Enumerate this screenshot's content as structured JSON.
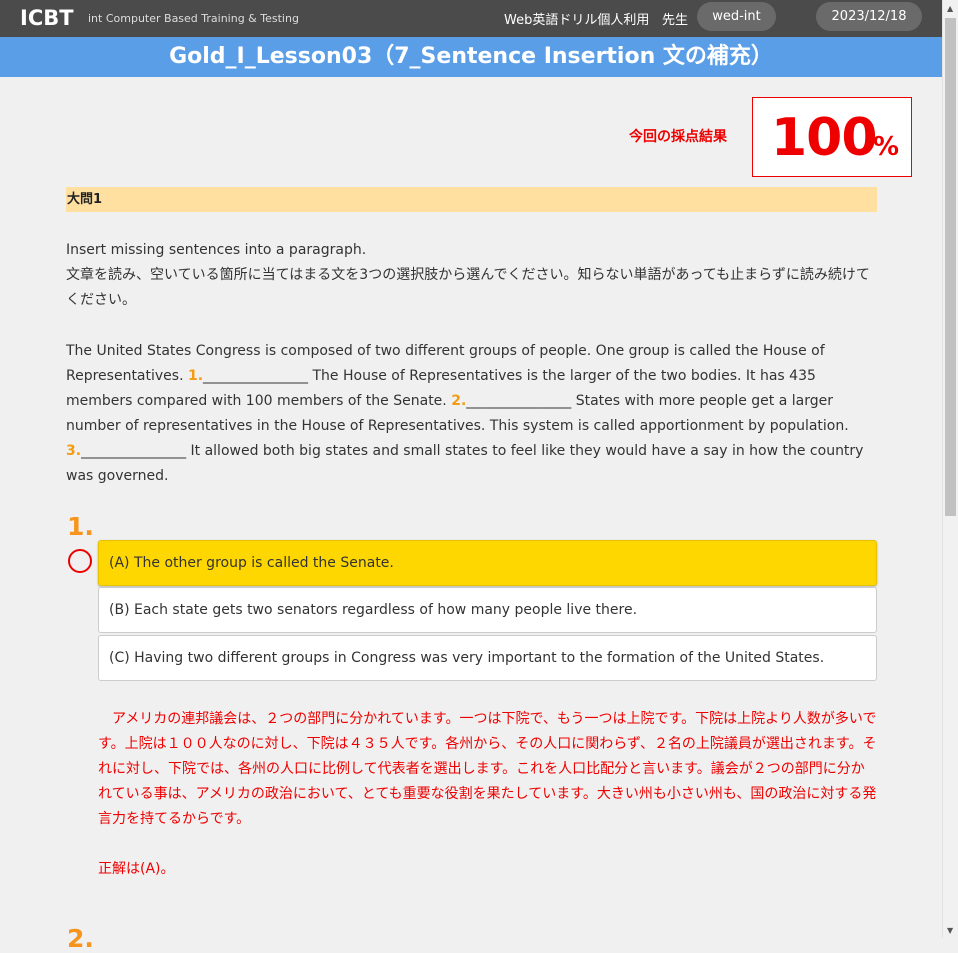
{
  "header": {
    "logo": "ICBT",
    "tagline": "int Computer Based Training & Testing",
    "service": "Web英語ドリル個人利用",
    "role": "先生",
    "user": "wed-int",
    "date": "2023/12/18"
  },
  "title": "Gold_I_Lesson03（7_Sentence Insertion 文の補充）",
  "score": {
    "label": "今回の採点結果",
    "value": "100",
    "unit": "%"
  },
  "section": {
    "heading": "大問1",
    "instruction_en": "Insert missing sentences into a paragraph.",
    "instruction_ja": "文章を読み、空いている箇所に当てはまる文を3つの選択肢から選んでください。知らない単語があっても止まらずに読み続けてください。"
  },
  "passage": {
    "p1": "The United States Congress is composed of two different groups of people. One group is called the House of Representatives.",
    "n1": "1.",
    "blank1": "_______________",
    "p2": "The House of Representatives is the larger of the two bodies. It has 435 members compared with 100 members of the Senate.",
    "n2": "2.",
    "blank2": "_______________",
    "p3": "States with more people get a larger number of representatives in the House of Representatives. This system is called apportionment by population.",
    "n3": "3.",
    "blank3": "_______________",
    "p4": "It allowed both big states and small states to feel like they would have a say in how the country was governed."
  },
  "question1": {
    "number": "1.",
    "result": "correct",
    "options": [
      {
        "label": "(A) The other group is called the Senate.",
        "selected": true
      },
      {
        "label": "(B) Each state gets two senators regardless of how many people live there.",
        "selected": false
      },
      {
        "label": "(C) Having two different groups in Congress was very important to the formation of the United States.",
        "selected": false
      }
    ],
    "explanation": "アメリカの連邦議会は、２つの部門に分かれています。一つは下院で、もう一つは上院です。下院は上院より人数が多いです。上院は１００人なのに対し、下院は４３５人です。各州から、その人口に関わらず、２名の上院議員が選出されます。それに対し、下院では、各州の人口に比例して代表者を選出します。これを人口比配分と言います。議会が２つの部門に分かれている事は、アメリカの政治において、とても重要な役割を果たしています。大きい州も小さい州も、国の政治に対する発言力を持てるからです。",
    "answer": "正解は(A)。"
  },
  "next_question_number": "2.",
  "colors": {
    "header_bg": "#4b4b4b",
    "title_bg": "#5b9ee8",
    "accent_orange": "#f7941d",
    "correct_red": "#e00000",
    "selected_option": "#ffd700",
    "section_bar": "#ffe0a0"
  }
}
